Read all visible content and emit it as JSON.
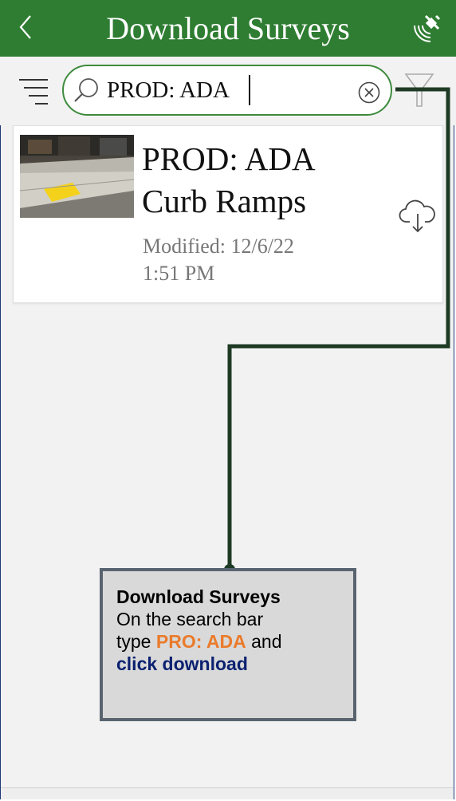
{
  "header": {
    "back_icon": "chevron-left-icon",
    "title": "Download Surveys",
    "gps_icon": "satellite-icon"
  },
  "toolbar": {
    "sort_icon": "sort-lines-icon",
    "search": {
      "value": "PROD: ADA",
      "icon": "search-icon"
    },
    "clear_icon": "clear-circle-icon",
    "filter_icon": "filter-icon"
  },
  "surveys": [
    {
      "title_line1": "PROD: ADA",
      "title_line2": "Curb Ramps",
      "modified_line1": "Modified: 12/6/22",
      "modified_line2": "1:51 PM",
      "action_icon": "cloud-download-icon"
    }
  ],
  "callout": {
    "heading": "Download Surveys",
    "line1": "On the search bar",
    "line2_prefix": "type ",
    "highlight_query": "PRO: ADA",
    "line2_suffix": " and",
    "action": "click download"
  },
  "colors": {
    "header_bg": "#2f7d32",
    "search_border": "#3d8b3d",
    "connector": "#1e3a24",
    "highlight_orange": "#ea7b2b",
    "highlight_navy": "#0b2170",
    "callout_bg": "#d9d9d9",
    "callout_border": "#5a6470"
  }
}
